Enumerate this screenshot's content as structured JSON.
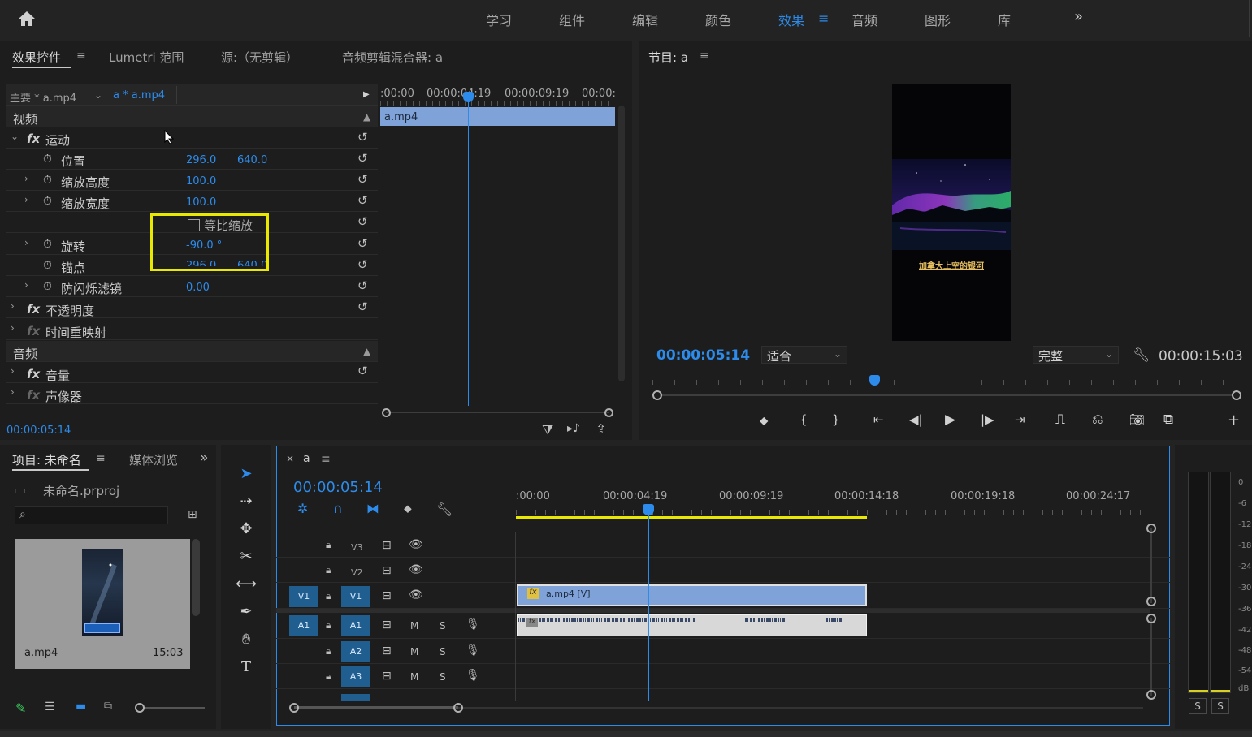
{
  "workspaces": [
    "学习",
    "组件",
    "编辑",
    "颜色",
    "效果",
    "音频",
    "图形",
    "库"
  ],
  "active_workspace": "效果",
  "ec": {
    "tabs": [
      "效果控件",
      "Lumetri 范围",
      "源:（无剪辑）",
      "音频剪辑混合器: a"
    ],
    "master_label": "主要 * a.mp4",
    "clip_label": "a * a.mp4",
    "mini_ruler": [
      ":00:00",
      "00:00:04:19",
      "00:00:09:19",
      "00:00:"
    ],
    "mini_clip": "a.mp4",
    "section_video": "视频",
    "motion": "运动",
    "position": {
      "label": "位置",
      "x": "296.0",
      "y": "640.0"
    },
    "scale_h": {
      "label": "缩放高度",
      "value": "100.0"
    },
    "scale_w": {
      "label": "缩放宽度",
      "value": "100.0"
    },
    "uniform": "等比缩放",
    "rotation": {
      "label": "旋转",
      "value": "-90.0 °"
    },
    "anchor": {
      "label": "锚点",
      "x": "296.0",
      "y": "640.0"
    },
    "flicker": {
      "label": "防闪烁滤镜",
      "value": "0.00"
    },
    "opacity": "不透明度",
    "time_remap": "时间重映射",
    "section_audio": "音频",
    "volume": "音量",
    "panner": "声像器",
    "timecode": "00:00:05:14"
  },
  "program": {
    "title": "节目: a",
    "caption": "加拿大上空的银河",
    "timecode": "00:00:05:14",
    "fit": "适合",
    "quality": "完整",
    "duration": "00:00:15:03"
  },
  "project": {
    "tabs": [
      "项目: 未命名",
      "媒体浏览"
    ],
    "file": "未命名.prproj",
    "clip_name": "a.mp4",
    "clip_duration": "15:03"
  },
  "timeline": {
    "seq_tab": "a",
    "timecode": "00:00:05:14",
    "ruler": [
      ":00:00",
      "00:00:04:19",
      "00:00:09:19",
      "00:00:14:18",
      "00:00:19:18",
      "00:00:24:17"
    ],
    "video_tracks": [
      {
        "src": "",
        "name": "V3"
      },
      {
        "src": "",
        "name": "V2"
      },
      {
        "src": "V1",
        "name": "V1"
      }
    ],
    "audio_tracks": [
      {
        "src": "A1",
        "name": "A1"
      },
      {
        "src": "",
        "name": "A2"
      },
      {
        "src": "",
        "name": "A3"
      }
    ],
    "clip_v": "a.mp4 [V]",
    "m": "M",
    "s": "S"
  },
  "meter": {
    "scale": [
      "0",
      "-6",
      "-12",
      "-18",
      "-24",
      "-30",
      "-36",
      "-42",
      "-48",
      "-54",
      "dB"
    ],
    "solo": [
      "S",
      "S"
    ]
  },
  "colors": {
    "accent": "#2d8ceb",
    "highlight": "#e8e800",
    "clip_video": "#7fa3d8"
  }
}
